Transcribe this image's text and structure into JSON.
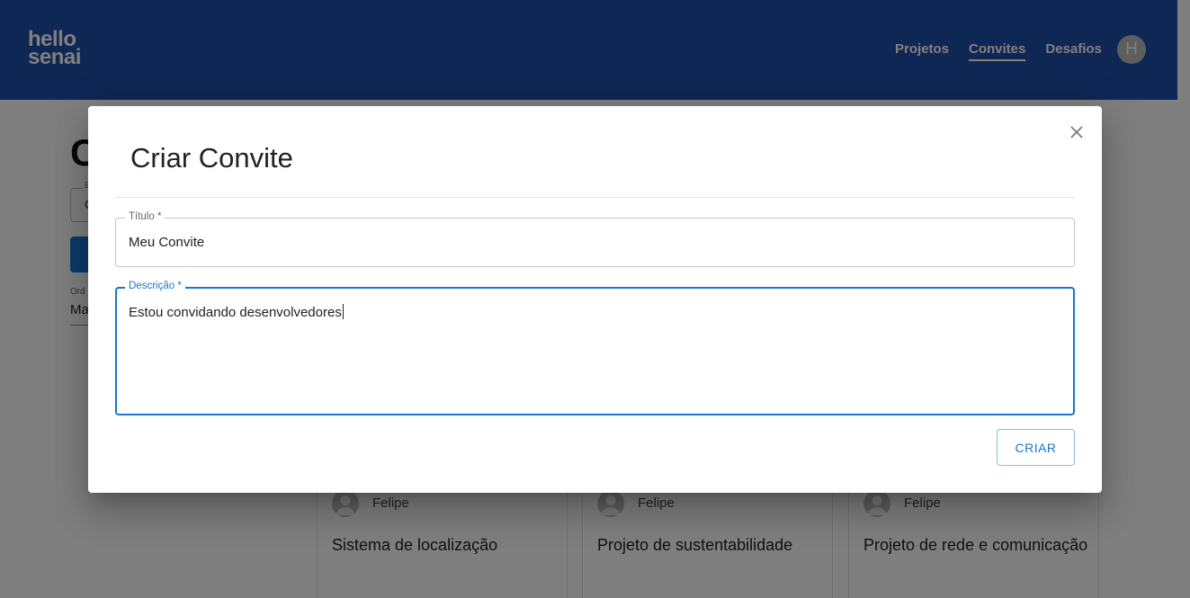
{
  "header": {
    "logo_line1": "hello",
    "logo_line2": "senai",
    "nav": [
      {
        "label": "Projetos"
      },
      {
        "label": "Convites"
      },
      {
        "label": "Desafios"
      }
    ],
    "active_nav": "Convites",
    "avatar_initial": "H"
  },
  "background": {
    "page_title_fragment": "C",
    "search_label_fragment": "B",
    "search_value_fragment": "C",
    "order_label_fragment": "Ord",
    "order_value_fragment": "Ma",
    "cards": [
      {
        "author": "Felipe",
        "title": "Sistema de localização"
      },
      {
        "author": "Felipe",
        "title": "Projeto de sustentabilidade"
      },
      {
        "author": "Felipe",
        "title": "Projeto de rede e comunicação"
      }
    ]
  },
  "dialog": {
    "title": "Criar Convite",
    "fields": {
      "titulo": {
        "label": "Título *",
        "value": "Meu Convite"
      },
      "descricao": {
        "label": "Descrição *",
        "value": "Estou convidando desenvolvedores"
      }
    },
    "submit_label": "CRIAR",
    "close_icon": "close-icon"
  },
  "colors": {
    "header_bg": "#1f4ea9",
    "primary": "#1976d2",
    "backdrop": "rgba(0,0,0,0.5)"
  }
}
